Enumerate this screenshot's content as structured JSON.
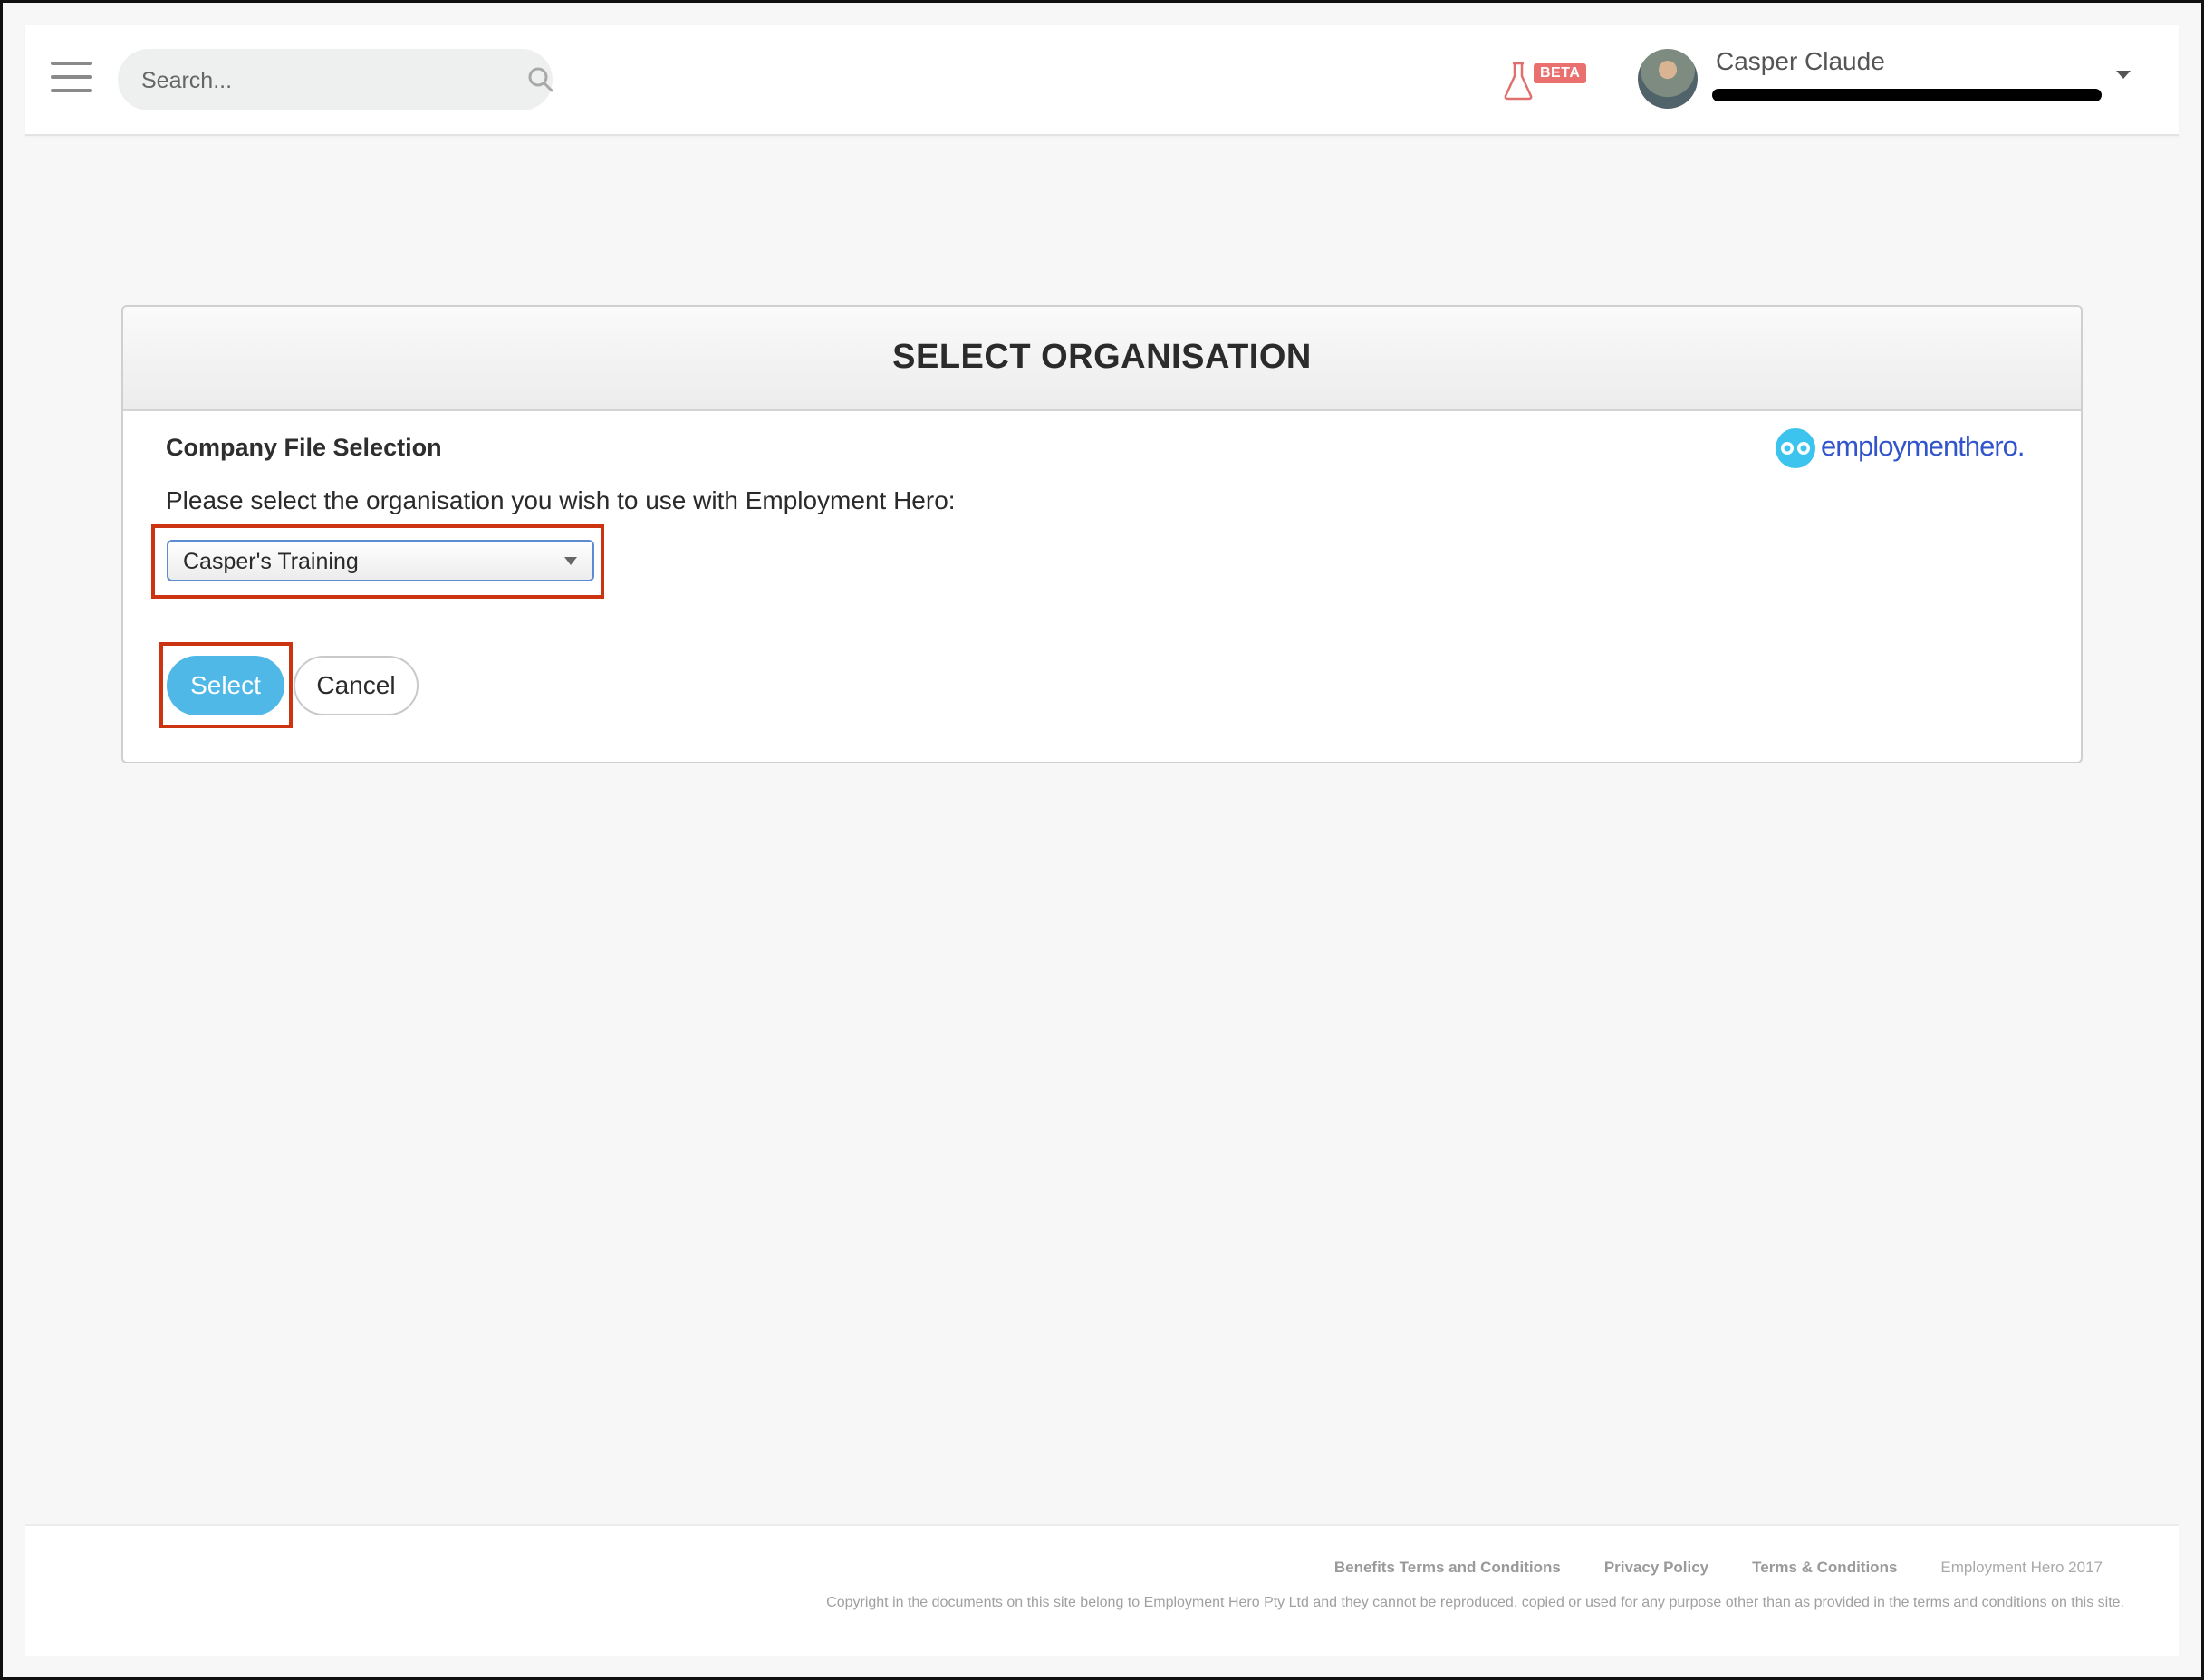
{
  "header": {
    "search_placeholder": "Search...",
    "beta_label": "BETA",
    "user_name": "Casper Claude"
  },
  "panel": {
    "title": "SELECT ORGANISATION",
    "section_label": "Company File Selection",
    "brand_name": "employmenthero.",
    "instruction": "Please select the organisation you wish to use with Employment Hero:",
    "selected_org": "Casper's Training",
    "select_button": "Select",
    "cancel_button": "Cancel"
  },
  "footer": {
    "links": [
      "Benefits Terms and Conditions",
      "Privacy Policy",
      "Terms & Conditions"
    ],
    "year_text": "Employment Hero 2017",
    "copyright": "Copyright in the documents on this site belong to Employment Hero Pty Ltd and they cannot be reproduced, copied or used for any purpose other than as provided in the terms and conditions on this site."
  },
  "colors": {
    "accent": "#4fb8e6",
    "brand": "#3355cc",
    "highlight": "#cc3311",
    "beta_badge": "#e9706f"
  }
}
